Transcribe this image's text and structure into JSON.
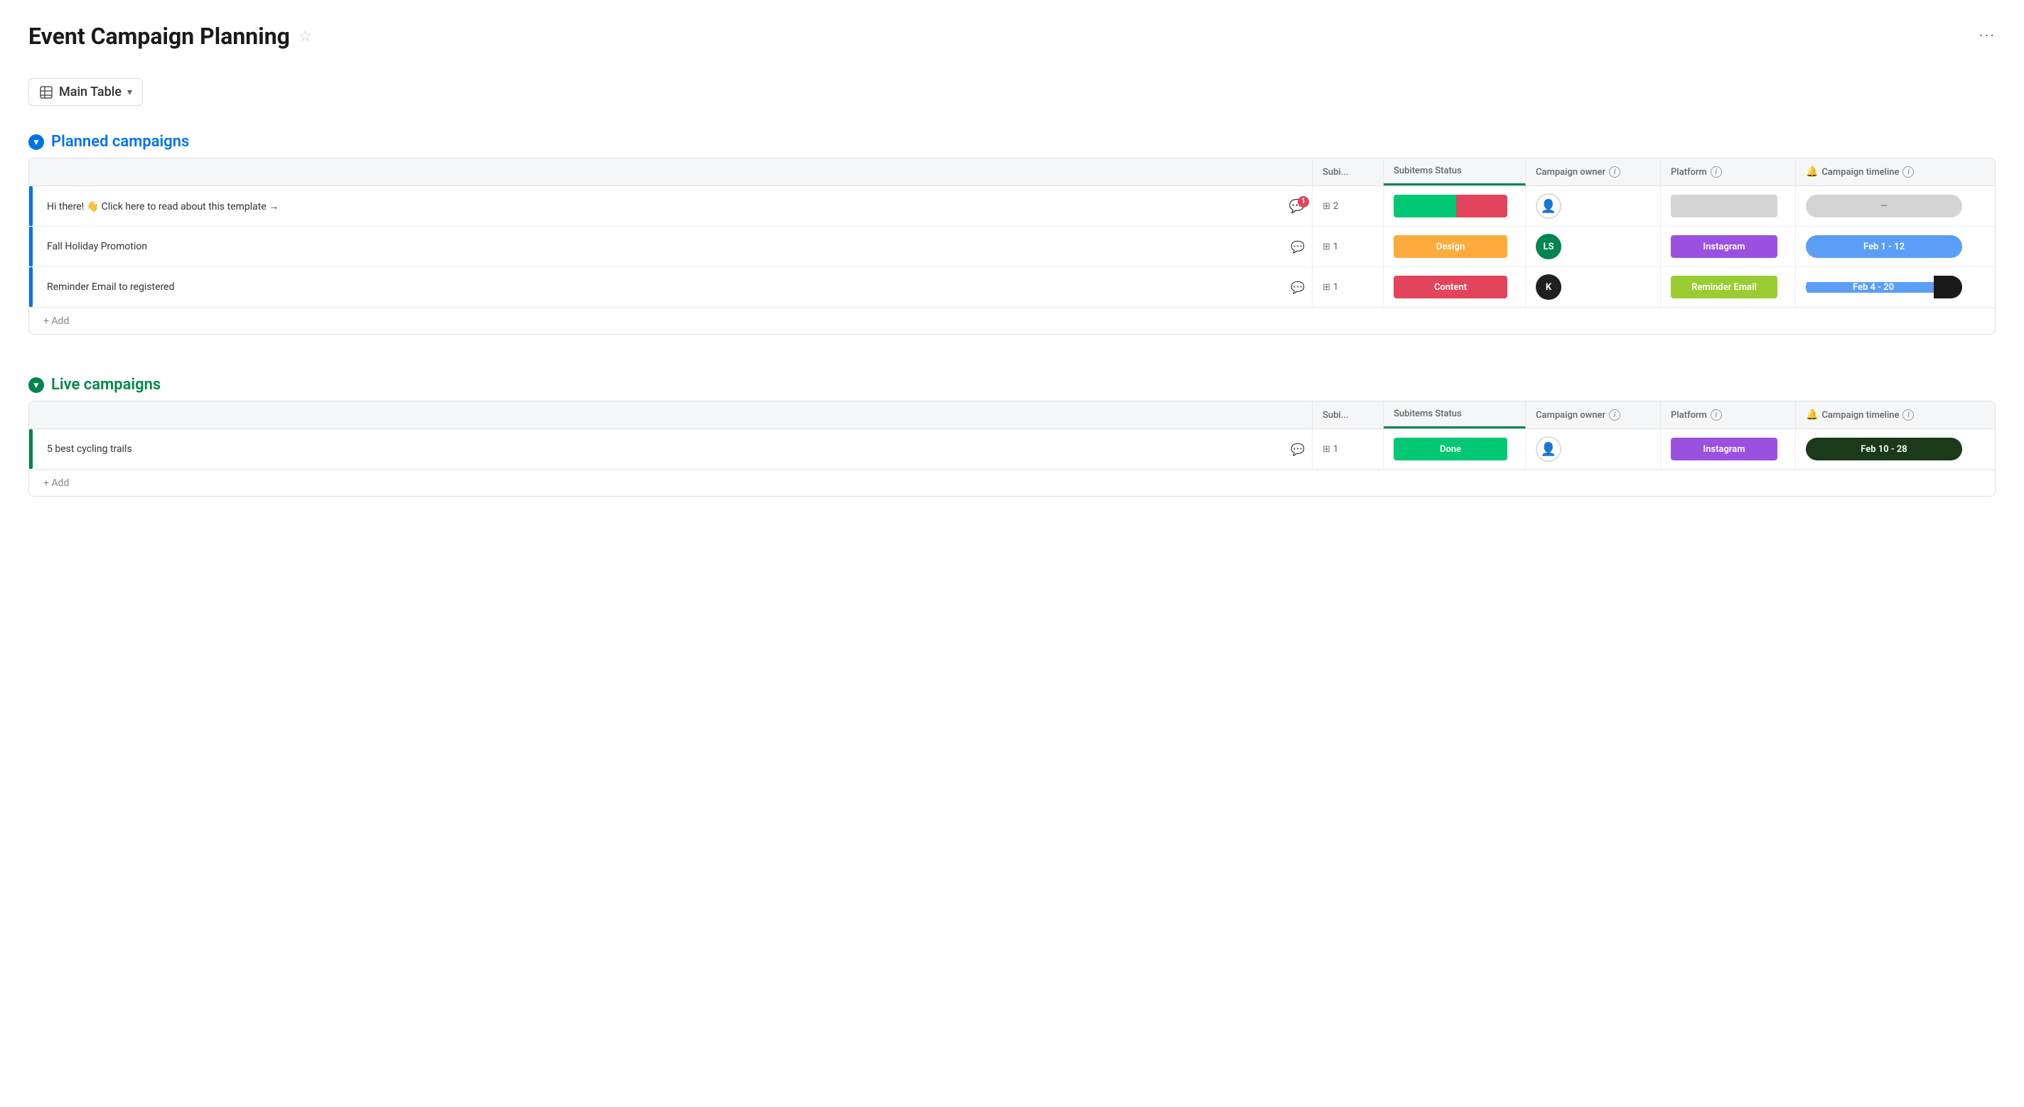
{
  "page": {
    "title": "Event Campaign Planning",
    "more_icon": "···"
  },
  "view": {
    "label": "Main Table",
    "chevron": "▾"
  },
  "groups": [
    {
      "id": "planned",
      "title": "Planned campaigns",
      "color": "blue",
      "accent_color": "#0073ea",
      "columns": {
        "subitems": "Subi...",
        "subitems_status": "Subitems Status",
        "campaign_owner": "Campaign owner",
        "platform": "Platform",
        "campaign_timeline": "Campaign timeline"
      },
      "rows": [
        {
          "name": "Hi there! 👋 Click here to read about this template →",
          "has_notification": true,
          "notification_count": 1,
          "subitems_count": 2,
          "status_type": "bar",
          "status_segments": [
            {
              "color": "#00c875",
              "width": "55%"
            },
            {
              "color": "#e2445c",
              "width": "45%"
            }
          ],
          "owner_type": "placeholder",
          "platform": "",
          "platform_color": "#d4d4d4",
          "timeline_type": "gray",
          "timeline_text": "—"
        },
        {
          "name": "Fall Holiday Promotion",
          "has_notification": false,
          "subitems_count": 1,
          "status_type": "single",
          "status_label": "Design",
          "status_color": "#fdab3d",
          "owner_initials": "LS",
          "owner_color": "#00854d",
          "platform": "Instagram",
          "platform_color": "#9b51e0",
          "timeline_type": "solid",
          "timeline_color": "#5b9ef6",
          "timeline_text": "Feb 1 - 12"
        },
        {
          "name": "Reminder Email to registered",
          "has_notification": false,
          "subitems_count": 1,
          "status_type": "single",
          "status_label": "Content",
          "status_color": "#e2445c",
          "owner_initials": "K",
          "owner_color": "#1f1f1f",
          "platform": "Reminder Email",
          "platform_color": "#9acd32",
          "timeline_type": "split",
          "timeline_text": "Feb 4 - 20"
        }
      ],
      "add_label": "+ Add"
    },
    {
      "id": "live",
      "title": "Live campaigns",
      "color": "green",
      "accent_color": "#00854d",
      "columns": {
        "subitems": "Subi...",
        "subitems_status": "Subitems Status",
        "campaign_owner": "Campaign owner",
        "platform": "Platform",
        "campaign_timeline": "Campaign timeline"
      },
      "rows": [
        {
          "name": "5 best cycling trails",
          "has_notification": false,
          "subitems_count": 1,
          "status_type": "single",
          "status_label": "Done",
          "status_color": "#00c875",
          "owner_type": "placeholder",
          "platform": "Instagram",
          "platform_color": "#9b51e0",
          "timeline_type": "dark",
          "timeline_text": "Feb 10 - 28"
        }
      ],
      "add_label": "+ Add"
    }
  ]
}
